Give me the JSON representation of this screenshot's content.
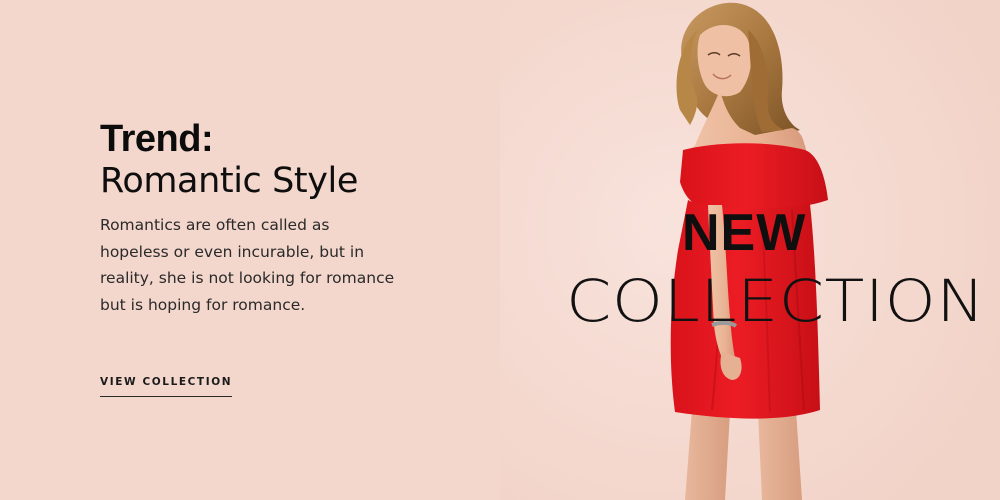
{
  "hero": {
    "kicker": "Trend:",
    "title": "Romantic Style",
    "description": "Romantics are often called as hopeless or even incurable, but in reality, she is not looking for romance but is hoping for romance.",
    "cta_label": "VIEW COLLECTION"
  },
  "banner": {
    "line1": "NEW",
    "line2": "COLLECTION"
  },
  "colors": {
    "background": "#f3d6cc",
    "dress": "#e4141a",
    "text": "#111111"
  }
}
